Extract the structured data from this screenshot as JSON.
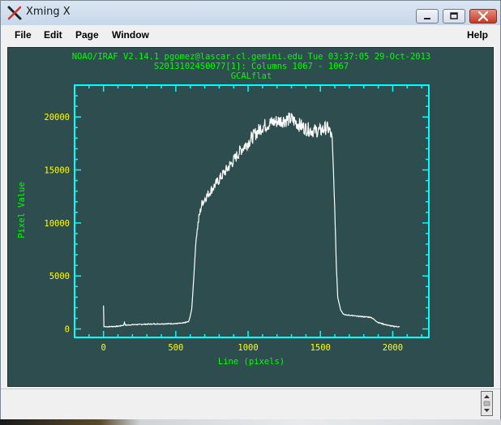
{
  "window": {
    "title": "Xming X",
    "icon": "x-logo-icon"
  },
  "menu": {
    "file": "File",
    "edit": "Edit",
    "page": "Page",
    "window": "Window",
    "help": "Help"
  },
  "header": {
    "line1": "NOAO/IRAF V2.14.1 pgomez@lascar.cl.gemini.edu Tue 03:37:05 29-Oct-2013",
    "line2": "S20131024S0077[1]: Columns 1067 - 1067",
    "line3": "GCALflat"
  },
  "colors": {
    "background": "#2d4d4e",
    "axes": "#00ffff",
    "labels": "#ffff00",
    "text": "#00ff00",
    "data": "#ffffff"
  },
  "chart_data": {
    "type": "line",
    "title": "GCALflat",
    "xlabel": "Line (pixels)",
    "ylabel": "Pixel Value",
    "xlim": [
      -200,
      2250
    ],
    "ylim": [
      -800,
      23000
    ],
    "xticks": [
      0,
      500,
      1000,
      1500,
      2000
    ],
    "yticks": [
      0,
      5000,
      10000,
      15000,
      20000
    ],
    "x_tick_labels": [
      "0",
      "500",
      "1000",
      "1500",
      "2000"
    ],
    "y_tick_labels": [
      "0",
      "5000",
      "10000",
      "15000",
      "20000"
    ],
    "grid": false,
    "series": [
      {
        "x": [
          0,
          2,
          5,
          10,
          100,
          140,
          145,
          150,
          200,
          300,
          400,
          500,
          550,
          590,
          610,
          625,
          640,
          660,
          680,
          700,
          750,
          800,
          850,
          900,
          950,
          1000,
          1050,
          1100,
          1150,
          1200,
          1250,
          1300,
          1350,
          1400,
          1450,
          1500,
          1540,
          1560,
          1580,
          1590,
          1600,
          1610,
          1620,
          1640,
          1660,
          1680,
          1700,
          1750,
          1800,
          1850,
          1870,
          1900,
          1950,
          2000,
          2050
        ],
        "y": [
          2200,
          200,
          250,
          200,
          250,
          350,
          700,
          350,
          400,
          450,
          480,
          500,
          550,
          700,
          1800,
          5000,
          8500,
          10500,
          11800,
          12300,
          13200,
          14100,
          15000,
          15900,
          16900,
          17600,
          18400,
          19100,
          19400,
          19600,
          19700,
          19800,
          19300,
          18900,
          18700,
          18700,
          19000,
          18800,
          18000,
          15000,
          11000,
          6000,
          3000,
          1800,
          1400,
          1300,
          1300,
          1200,
          1150,
          1100,
          900,
          600,
          400,
          250,
          200
        ]
      }
    ]
  }
}
